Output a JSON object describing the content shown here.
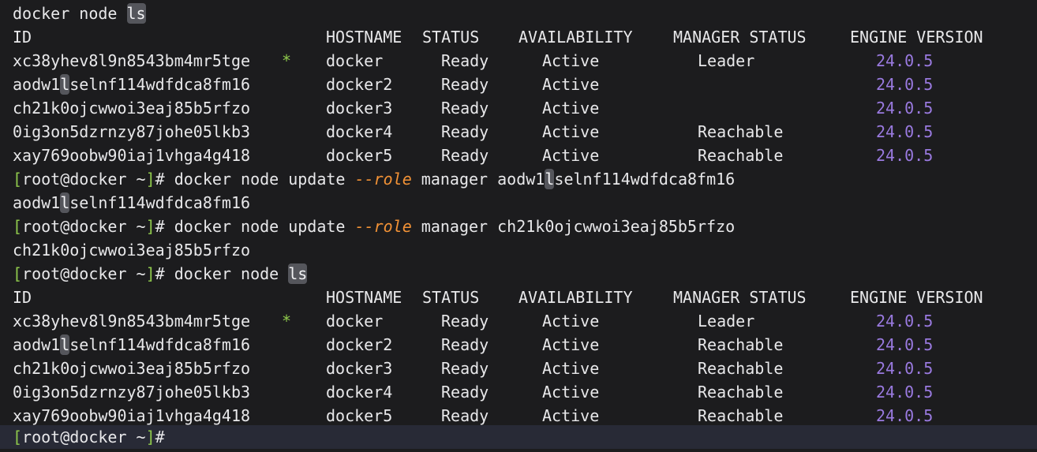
{
  "terminal": {
    "background_color": "#1c1c1e",
    "foreground_color": "#e8e8ea",
    "current_line_color": "#282a36",
    "highlight_color": "#55565c",
    "accent_colors": {
      "prompt_bracket": "#8fc94c",
      "flag": "#f29236",
      "version": "#9a7ae0",
      "leader_star": "#8fc94c"
    },
    "prompt": {
      "open_bracket": "[",
      "user_host": "root@docker ~",
      "close_bracket": "]",
      "sigil": "#"
    },
    "table_headers": {
      "id": "ID",
      "hostname": "HOSTNAME",
      "status": "STATUS",
      "availability": "AVAILABILITY",
      "manager_status": "MANAGER STATUS",
      "engine_version": "ENGINE VERSION"
    },
    "commands": {
      "node_ls": "docker node ls",
      "node_ls_prefix": "docker node ",
      "node_ls_highlight": "ls",
      "update_prefix": "docker node update ",
      "update_flag": "--role",
      "update_role": " manager ",
      "node_id_aodw_prefix": "aodw1",
      "node_id_aodw_highlight": "l",
      "node_id_aodw_suffix": "selnf114wdfdca8fm16",
      "node_id_ch21": "ch21k0ojcwwoi3eaj85b5rfzo"
    },
    "output_echo": {
      "aodw_prefix": "aodw1",
      "aodw_highlight": "l",
      "aodw_suffix": "selnf114wdfdca8fm16",
      "ch21": "ch21k0ojcwwoi3eaj85b5rfzo"
    },
    "table_1": {
      "rows": [
        {
          "id_prefix": "xc38yhev8l9n8543bm4mr5tge",
          "id_highlight": "",
          "id_suffix": "",
          "star": "*",
          "hostname": "docker",
          "status": "Ready",
          "availability": "Active",
          "manager_status": "Leader",
          "engine_version": "24.0.5"
        },
        {
          "id_prefix": "aodw1",
          "id_highlight": "l",
          "id_suffix": "selnf114wdfdca8fm16",
          "star": "",
          "hostname": "docker2",
          "status": "Ready",
          "availability": "Active",
          "manager_status": "",
          "engine_version": "24.0.5"
        },
        {
          "id_prefix": "ch21k0ojcwwoi3eaj85b5rfzo",
          "id_highlight": "",
          "id_suffix": "",
          "star": "",
          "hostname": "docker3",
          "status": "Ready",
          "availability": "Active",
          "manager_status": "",
          "engine_version": "24.0.5"
        },
        {
          "id_prefix": "0ig3on5dzrnzy87johe05lkb3",
          "id_highlight": "",
          "id_suffix": "",
          "star": "",
          "hostname": "docker4",
          "status": "Ready",
          "availability": "Active",
          "manager_status": "Reachable",
          "engine_version": "24.0.5"
        },
        {
          "id_prefix": "xay769oobw90iaj1vhga4g418",
          "id_highlight": "",
          "id_suffix": "",
          "star": "",
          "hostname": "docker5",
          "status": "Ready",
          "availability": "Active",
          "manager_status": "Reachable",
          "engine_version": "24.0.5"
        }
      ]
    },
    "table_2": {
      "rows": [
        {
          "id_prefix": "xc38yhev8l9n8543bm4mr5tge",
          "id_highlight": "",
          "id_suffix": "",
          "star": "*",
          "hostname": "docker",
          "status": "Ready",
          "availability": "Active",
          "manager_status": "Leader",
          "engine_version": "24.0.5"
        },
        {
          "id_prefix": "aodw1",
          "id_highlight": "l",
          "id_suffix": "selnf114wdfdca8fm16",
          "star": "",
          "hostname": "docker2",
          "status": "Ready",
          "availability": "Active",
          "manager_status": "Reachable",
          "engine_version": "24.0.5"
        },
        {
          "id_prefix": "ch21k0ojcwwoi3eaj85b5rfzo",
          "id_highlight": "",
          "id_suffix": "",
          "star": "",
          "hostname": "docker3",
          "status": "Ready",
          "availability": "Active",
          "manager_status": "Reachable",
          "engine_version": "24.0.5"
        },
        {
          "id_prefix": "0ig3on5dzrnzy87johe05lkb3",
          "id_highlight": "",
          "id_suffix": "",
          "star": "",
          "hostname": "docker4",
          "status": "Ready",
          "availability": "Active",
          "manager_status": "Reachable",
          "engine_version": "24.0.5"
        },
        {
          "id_prefix": "xay769oobw90iaj1vhga4g418",
          "id_highlight": "",
          "id_suffix": "",
          "star": "",
          "hostname": "docker5",
          "status": "Ready",
          "availability": "Active",
          "manager_status": "Reachable",
          "engine_version": "24.0.5"
        }
      ]
    }
  }
}
